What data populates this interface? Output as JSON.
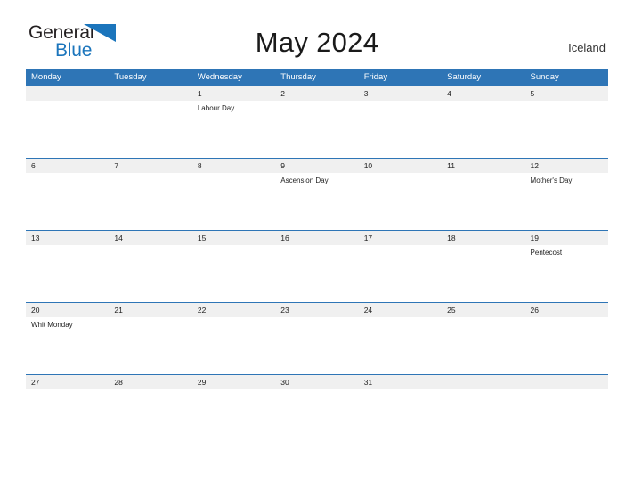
{
  "logo": {
    "text_primary": "General",
    "text_secondary": "Blue",
    "flag_icon": "blue-flag-triangle-icon",
    "primary_color": "#231f20",
    "secondary_color": "#1b75bc"
  },
  "header": {
    "title": "May 2024",
    "country": "Iceland"
  },
  "theme": {
    "header_blue": "#2e75b6",
    "date_band_gray": "#f0f0f0",
    "row_border_blue": "#2e75b6",
    "text_dark": "#222222",
    "page_background": "#ffffff"
  },
  "calendar": {
    "month": "May",
    "year": "2024",
    "week_start": "Monday",
    "weekdays": [
      "Monday",
      "Tuesday",
      "Wednesday",
      "Thursday",
      "Friday",
      "Saturday",
      "Sunday"
    ],
    "weeks": [
      {
        "days": [
          {
            "number": "",
            "event": ""
          },
          {
            "number": "",
            "event": ""
          },
          {
            "number": "1",
            "event": "Labour Day"
          },
          {
            "number": "2",
            "event": ""
          },
          {
            "number": "3",
            "event": ""
          },
          {
            "number": "4",
            "event": ""
          },
          {
            "number": "5",
            "event": ""
          }
        ]
      },
      {
        "days": [
          {
            "number": "6",
            "event": ""
          },
          {
            "number": "7",
            "event": ""
          },
          {
            "number": "8",
            "event": ""
          },
          {
            "number": "9",
            "event": "Ascension Day"
          },
          {
            "number": "10",
            "event": ""
          },
          {
            "number": "11",
            "event": ""
          },
          {
            "number": "12",
            "event": "Mother's Day"
          }
        ]
      },
      {
        "days": [
          {
            "number": "13",
            "event": ""
          },
          {
            "number": "14",
            "event": ""
          },
          {
            "number": "15",
            "event": ""
          },
          {
            "number": "16",
            "event": ""
          },
          {
            "number": "17",
            "event": ""
          },
          {
            "number": "18",
            "event": ""
          },
          {
            "number": "19",
            "event": "Pentecost"
          }
        ]
      },
      {
        "days": [
          {
            "number": "20",
            "event": "Whit Monday"
          },
          {
            "number": "21",
            "event": ""
          },
          {
            "number": "22",
            "event": ""
          },
          {
            "number": "23",
            "event": ""
          },
          {
            "number": "24",
            "event": ""
          },
          {
            "number": "25",
            "event": ""
          },
          {
            "number": "26",
            "event": ""
          }
        ]
      },
      {
        "days": [
          {
            "number": "27",
            "event": ""
          },
          {
            "number": "28",
            "event": ""
          },
          {
            "number": "29",
            "event": ""
          },
          {
            "number": "30",
            "event": ""
          },
          {
            "number": "31",
            "event": ""
          },
          {
            "number": "",
            "event": ""
          },
          {
            "number": "",
            "event": ""
          }
        ]
      }
    ]
  }
}
